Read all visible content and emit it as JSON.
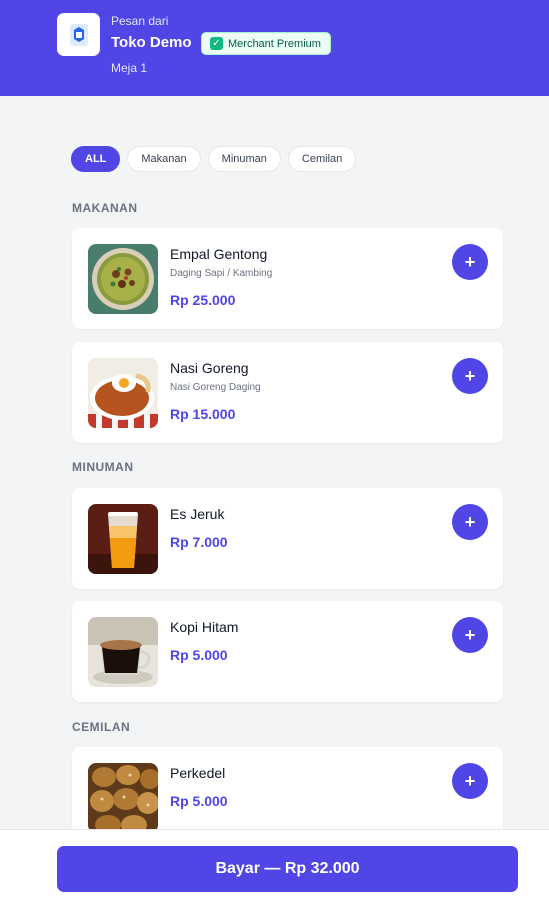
{
  "header": {
    "subtitle": "Pesan dari",
    "store_name": "Toko Demo",
    "badge_label": "Merchant Premium",
    "table": "Meja 1"
  },
  "filters": [
    {
      "label": "ALL",
      "active": true
    },
    {
      "label": "Makanan",
      "active": false
    },
    {
      "label": "Minuman",
      "active": false
    },
    {
      "label": "Cemilan",
      "active": false
    }
  ],
  "sections": [
    {
      "title": "MAKANAN",
      "items": [
        {
          "name": "Empal Gentong",
          "description": "Daging Sapi / Kambing",
          "price": "Rp 25.000",
          "image": "empal-gentong-photo"
        },
        {
          "name": "Nasi Goreng",
          "description": "Nasi Goreng Daging",
          "price": "Rp 15.000",
          "image": "nasi-goreng-photo"
        }
      ]
    },
    {
      "title": "MINUMAN",
      "items": [
        {
          "name": "Es Jeruk",
          "description": "",
          "price": "Rp 7.000",
          "image": "es-jeruk-photo"
        },
        {
          "name": "Kopi Hitam",
          "description": "",
          "price": "Rp 5.000",
          "image": "kopi-hitam-photo"
        }
      ]
    },
    {
      "title": "CEMILAN",
      "items": [
        {
          "name": "Perkedel",
          "description": "",
          "price": "Rp 5.000",
          "image": "perkedel-photo"
        }
      ]
    }
  ],
  "add_button_icon": "plus-icon",
  "checkout": {
    "label": "Bayar — Rp 32.000"
  },
  "colors": {
    "primary": "#4f46e5",
    "badge_bg": "#ecfdf5",
    "badge_check": "#10b981",
    "background": "#f3f4f6"
  }
}
